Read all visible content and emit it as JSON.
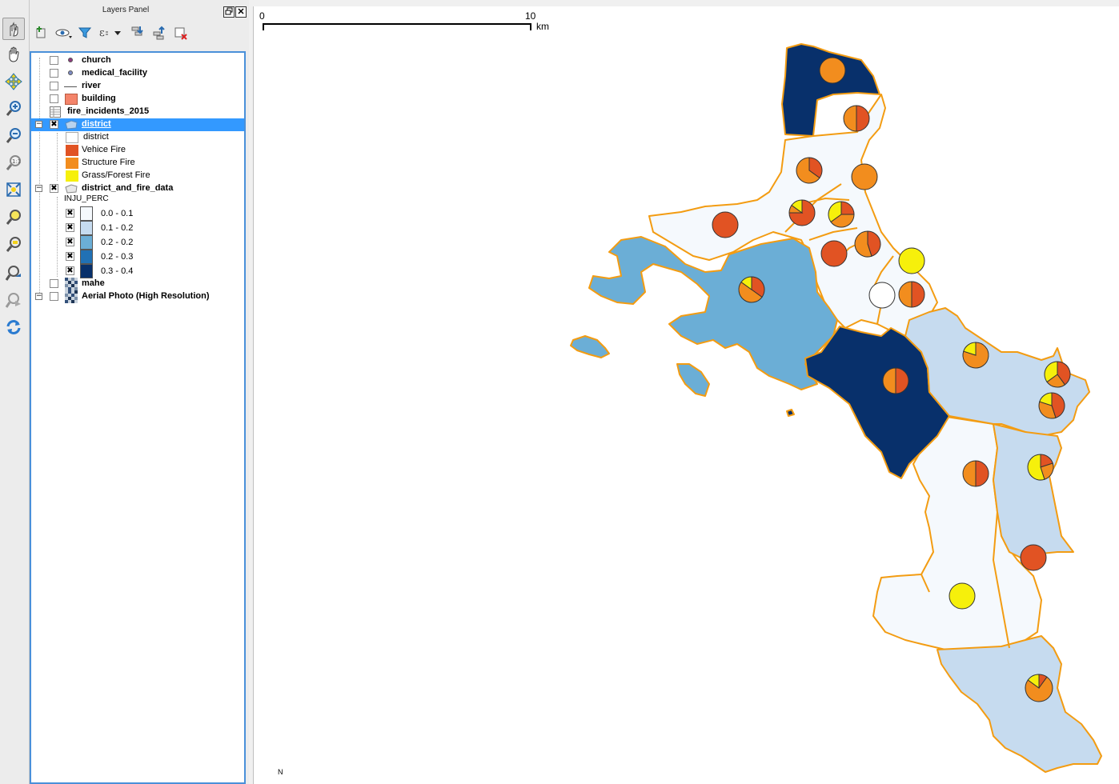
{
  "panel": {
    "title": "Layers Panel",
    "restore_icon": "restore-icon",
    "close_icon": "close-icon"
  },
  "map_tools": [
    "touch-select-icon",
    "pan-icon",
    "pan-to-selection-icon",
    "zoom-in-icon",
    "zoom-out-icon",
    "zoom-native-icon",
    "zoom-full-icon",
    "zoom-to-selection-icon",
    "zoom-to-layer-icon",
    "zoom-last-icon",
    "zoom-next-icon",
    "refresh-icon"
  ],
  "panel_tools": [
    "add-group-icon",
    "visibility-icon",
    "filter-icon",
    "expression-filter-icon",
    "expand-all-icon",
    "collapse-all-icon",
    "remove-layer-icon"
  ],
  "layers": {
    "church": "church",
    "medical_facility": "medical_facility",
    "river": "river",
    "building": "building",
    "fire_incidents": "fire_incidents_2015",
    "district": "district",
    "district_sym": "district",
    "vehicle": "Vehice Fire",
    "structure": "Structure Fire",
    "grass": "Grass/Forest Fire",
    "district_fire": "district_and_fire_data",
    "inju_field": "INJU_PERC",
    "c1": "0.0 - 0.1",
    "c2": "0.1 - 0.2",
    "c3": "0.2 - 0.2",
    "c4": "0.2 - 0.3",
    "c5": "0.3 - 0.4",
    "mahe": "mahe",
    "aerial": "Aerial Photo (High Resolution)"
  },
  "check_mark": "✖",
  "colors": {
    "vehicle_fire": "#e15323",
    "structure_fire": "#f28d1e",
    "grass_fire": "#f6f00b",
    "boundary": "#f39c12",
    "class_1": "#f5f9fd",
    "class_2": "#c6dbef",
    "class_3": "#6baed6",
    "class_4": "#2171b5",
    "class_5": "#08306b",
    "selection": "#3399ff"
  },
  "scalebar": {
    "start": "0",
    "end": "10",
    "unit": "km"
  },
  "north_label": "N"
}
